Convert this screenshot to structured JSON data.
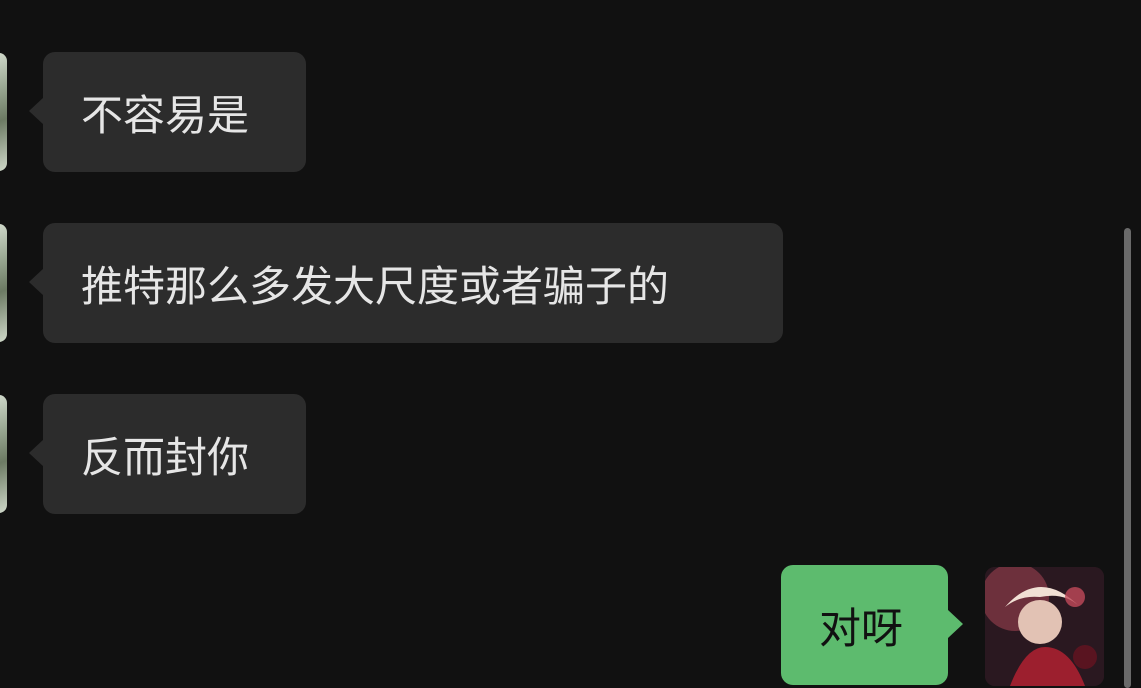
{
  "messages": [
    {
      "direction": "incoming",
      "text": "不容易是"
    },
    {
      "direction": "incoming",
      "text": "推特那么多发大尺度或者骗子的"
    },
    {
      "direction": "incoming",
      "text": "反而封你"
    },
    {
      "direction": "outgoing",
      "text": "对呀"
    }
  ],
  "colors": {
    "background": "#111111",
    "incoming_bubble": "#2c2c2c",
    "outgoing_bubble": "#5dbb6e",
    "incoming_text": "#e6e6e6",
    "outgoing_text": "#111111"
  }
}
